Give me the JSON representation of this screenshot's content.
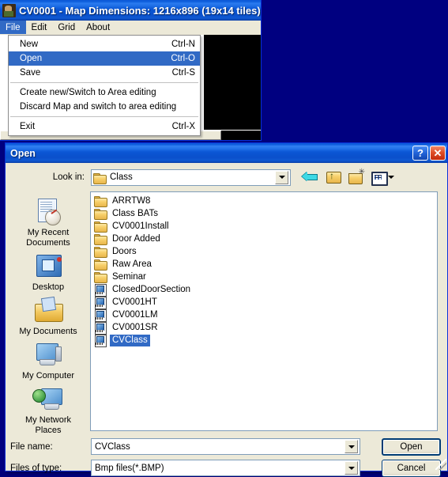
{
  "desktop": {
    "background_color": "#000080"
  },
  "app_window": {
    "icon": "app-sprite-icon",
    "title": "CV0001 - Map Dimensions: 1216x896 (19x14 tiles)",
    "menubar": [
      {
        "label": "File",
        "active": true
      },
      {
        "label": "Edit",
        "active": false
      },
      {
        "label": "Grid",
        "active": false
      },
      {
        "label": "About",
        "active": false
      }
    ]
  },
  "file_menu": {
    "groups": [
      [
        {
          "label": "New",
          "accel": "Ctrl-N",
          "highlighted": false
        },
        {
          "label": "Open",
          "accel": "Ctrl-O",
          "highlighted": true
        },
        {
          "label": "Save",
          "accel": "Ctrl-S",
          "highlighted": false
        }
      ],
      [
        {
          "label": "Create new/Switch to Area editing",
          "accel": "",
          "highlighted": false
        },
        {
          "label": "Discard Map and switch to area editing",
          "accel": "",
          "highlighted": false
        }
      ],
      [
        {
          "label": "Exit",
          "accel": "Ctrl-X",
          "highlighted": false
        }
      ]
    ]
  },
  "open_dialog": {
    "title": "Open",
    "help_button": "?",
    "close_button": "✕",
    "lookin": {
      "label": "Look in:",
      "value": "Class",
      "icon": "folder-icon"
    },
    "toolbar": [
      {
        "name": "back-icon",
        "tooltip": "Back"
      },
      {
        "name": "up-folder-icon",
        "tooltip": "Up One Level"
      },
      {
        "name": "new-folder-icon",
        "tooltip": "Create New Folder"
      },
      {
        "name": "views-icon",
        "tooltip": "Views"
      }
    ],
    "places": [
      {
        "label": "My Recent\nDocuments",
        "icon": "recent-documents-icon"
      },
      {
        "label": "Desktop",
        "icon": "desktop-icon"
      },
      {
        "label": "My Documents",
        "icon": "my-documents-icon"
      },
      {
        "label": "My Computer",
        "icon": "my-computer-icon"
      },
      {
        "label": "My Network\nPlaces",
        "icon": "my-network-places-icon"
      }
    ],
    "files": [
      {
        "name": "ARRTW8",
        "type": "folder",
        "selected": false
      },
      {
        "name": "Class BATs",
        "type": "folder",
        "selected": false
      },
      {
        "name": "CV0001Install",
        "type": "folder",
        "selected": false
      },
      {
        "name": "Door Added",
        "type": "folder",
        "selected": false
      },
      {
        "name": "Doors",
        "type": "folder",
        "selected": false
      },
      {
        "name": "Raw Area",
        "type": "folder",
        "selected": false
      },
      {
        "name": "Seminar",
        "type": "folder",
        "selected": false
      },
      {
        "name": "ClosedDoorSection",
        "type": "bmp",
        "selected": false
      },
      {
        "name": "CV0001HT",
        "type": "bmp",
        "selected": false
      },
      {
        "name": "CV0001LM",
        "type": "bmp",
        "selected": false
      },
      {
        "name": "CV0001SR",
        "type": "bmp",
        "selected": false
      },
      {
        "name": "CVClass",
        "type": "bmp",
        "selected": true
      }
    ],
    "filename": {
      "label": "File name:",
      "value": "CVClass",
      "placeholder": ""
    },
    "filetype": {
      "label": "Files of type:",
      "value": "Bmp files(*.BMP)",
      "options": [
        "Bmp files(*.BMP)"
      ]
    },
    "buttons": {
      "open": "Open",
      "cancel": "Cancel"
    }
  },
  "colors": {
    "titlebar_blue": "#0a56d4",
    "dialog_face": "#ece9d8",
    "selection_blue": "#316ac5",
    "desktop_blue": "#000080",
    "list_border": "#7f9db9"
  }
}
